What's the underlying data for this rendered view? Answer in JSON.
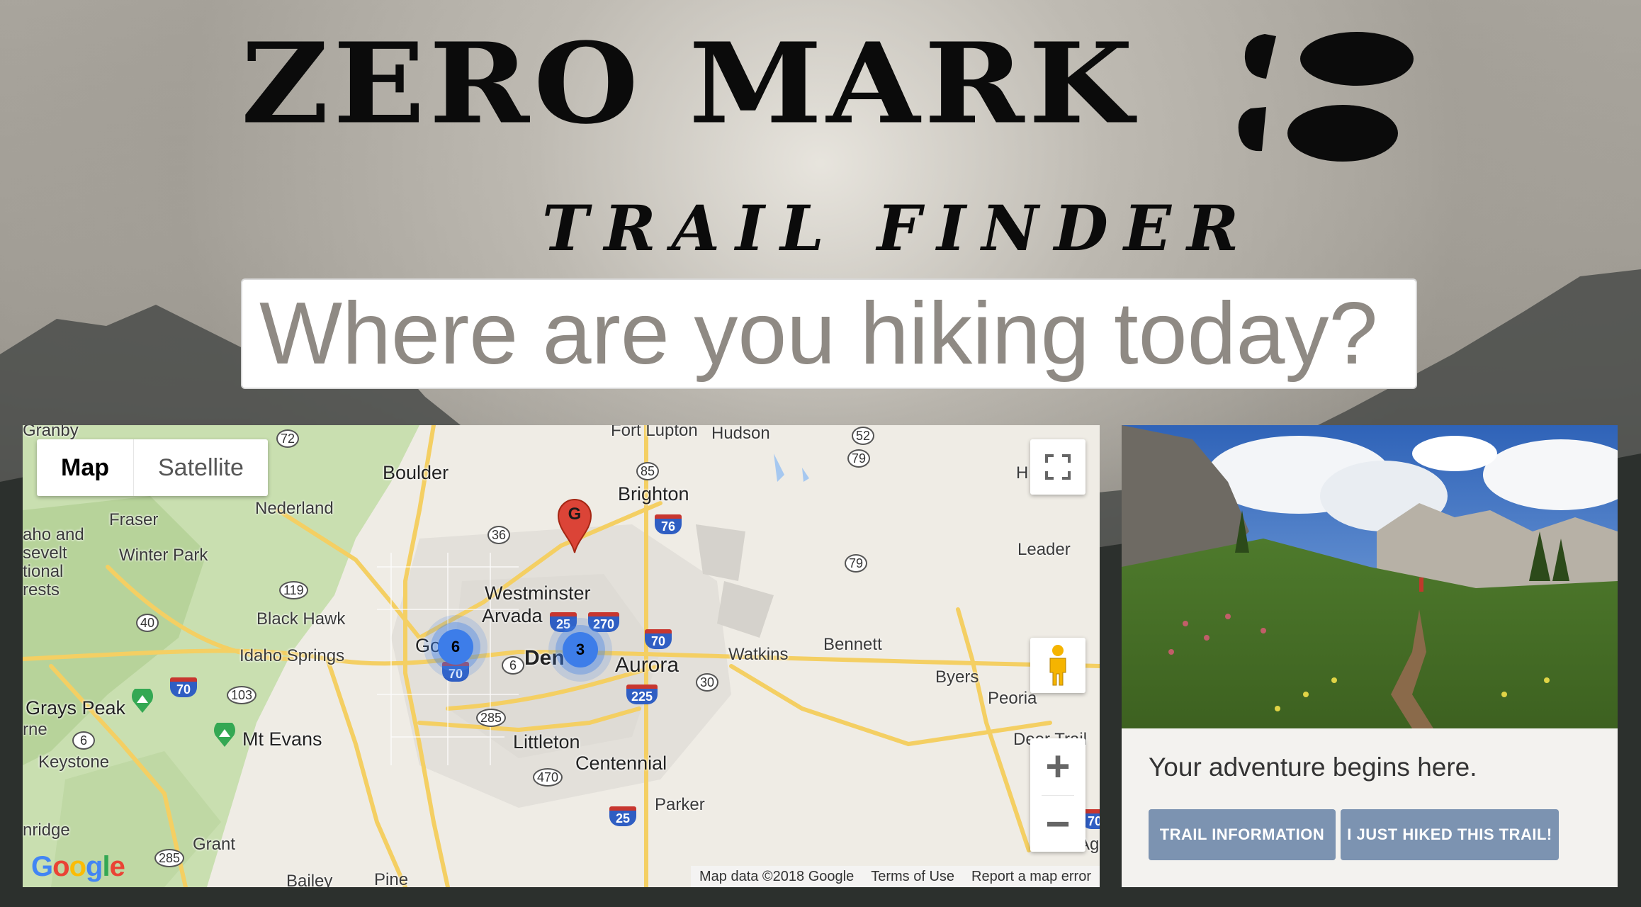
{
  "header": {
    "title": "ZERO MARK",
    "subtitle": "TRAIL FINDER",
    "logo_icon": "footprints-icon"
  },
  "search": {
    "placeholder": "Where are you hiking today?",
    "value": ""
  },
  "map": {
    "type_buttons": [
      "Map",
      "Satellite"
    ],
    "active_type": "Map",
    "places": {
      "granby": "Granby",
      "fort_lupton": "Fort Lupton",
      "hudson": "Hudson",
      "boulder": "Boulder",
      "brighton": "Brighton",
      "fraser": "Fraser",
      "nederland": "Nederland",
      "arapaho": "aho and\nsevelt\ntional\nrests",
      "winter_park": "Winter Park",
      "leader": "Leader",
      "westminster": "Westminster",
      "arvada": "Arvada",
      "black_hawk": "Black Hawk",
      "idaho_springs": "Idaho Springs",
      "golden": "Go",
      "denver": "Den",
      "aurora": "Aurora",
      "watkins": "Watkins",
      "bennett": "Bennett",
      "byers": "Byers",
      "peoria": "Peoria",
      "grays_peak": "Grays Peak",
      "mt_evans": "Mt Evans",
      "orne": "rne",
      "keystone": "Keystone",
      "littleton": "Littleton",
      "centennial": "Centennial",
      "deer_trail": "Deer Trail",
      "parker": "Parker",
      "breckenridge": "nridge",
      "grant": "Grant",
      "bailey": "Bailey",
      "pine": "Pine",
      "ag": "Ag",
      "h": "H"
    },
    "highways": [
      "72",
      "52",
      "85",
      "79",
      "76",
      "36",
      "79",
      "119",
      "40",
      "25",
      "270",
      "70",
      "6",
      "70",
      "225",
      "30",
      "70",
      "103",
      "285",
      "6",
      "470",
      "25",
      "285",
      "70"
    ],
    "clusters": [
      {
        "label": "6"
      },
      {
        "label": "3"
      }
    ],
    "marker_label": "G",
    "zoom_in": "+",
    "zoom_out": "−",
    "google_logo": "Google",
    "footer": {
      "data": "Map data ©2018 Google",
      "terms": "Terms of Use",
      "report": "Report a map error"
    }
  },
  "card": {
    "tagline": "Your adventure begins here.",
    "buttons": {
      "info": "TRAIL INFORMATION",
      "hiked": "I JUST HIKED THIS TRAIL!"
    }
  },
  "colors": {
    "button_bg": "#7c93b1",
    "cluster": "#3d7de9",
    "marker": "#db4437"
  }
}
